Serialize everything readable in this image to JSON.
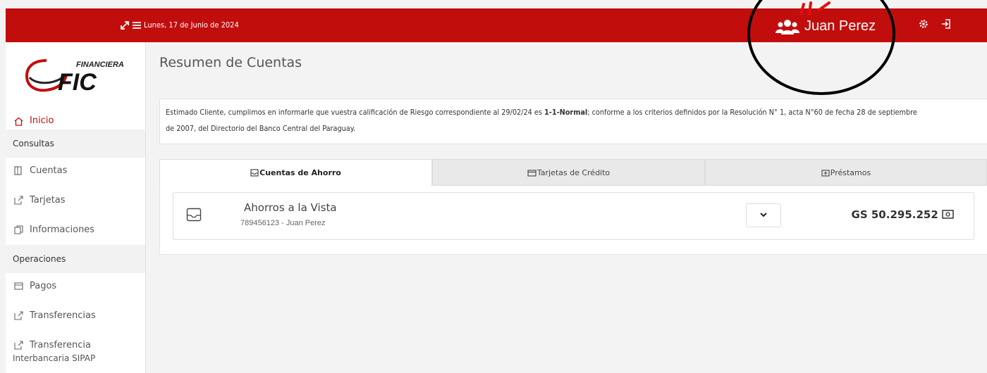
{
  "header": {
    "date": "Lunes, 17 de Junio de 2024",
    "user_name": "Juan Perez",
    "accent_color": "#c20d0d"
  },
  "brand": {
    "top_text": "FINANCIERA",
    "name": "FIC"
  },
  "sidebar": {
    "home_label": "Inicio",
    "section_consultas": "Consultas",
    "consultas_items": [
      "Cuentas",
      "Tarjetas",
      "Informaciones"
    ],
    "section_operaciones": "Operaciones",
    "operaciones_items": [
      "Pagos",
      "Transferencias",
      "Transferencia",
      "Interbancaria SIPAP"
    ]
  },
  "main": {
    "title": "Resumen de Cuentas",
    "notice_pre": "Estimado Cliente, cumplimos en informarle que vuestra calificación de Riesgo correspondiente al 29/02/24 es ",
    "notice_bold": "1-1-Normal",
    "notice_post": "; conforme a los criterios definidos por la Resolución N° 1, acta N°60 de fecha 28 de septiembre",
    "notice_line2": "de 2007, del Directorio del Banco Central del Paraguay.",
    "tabs": [
      "Cuentas de Ahorro",
      "Tarjetas de Crédito",
      "Préstamos"
    ],
    "account": {
      "name": "Ahorros a la Vista",
      "number": "789456123 - Juan Perez",
      "balance": "GS 50.295.252"
    }
  }
}
